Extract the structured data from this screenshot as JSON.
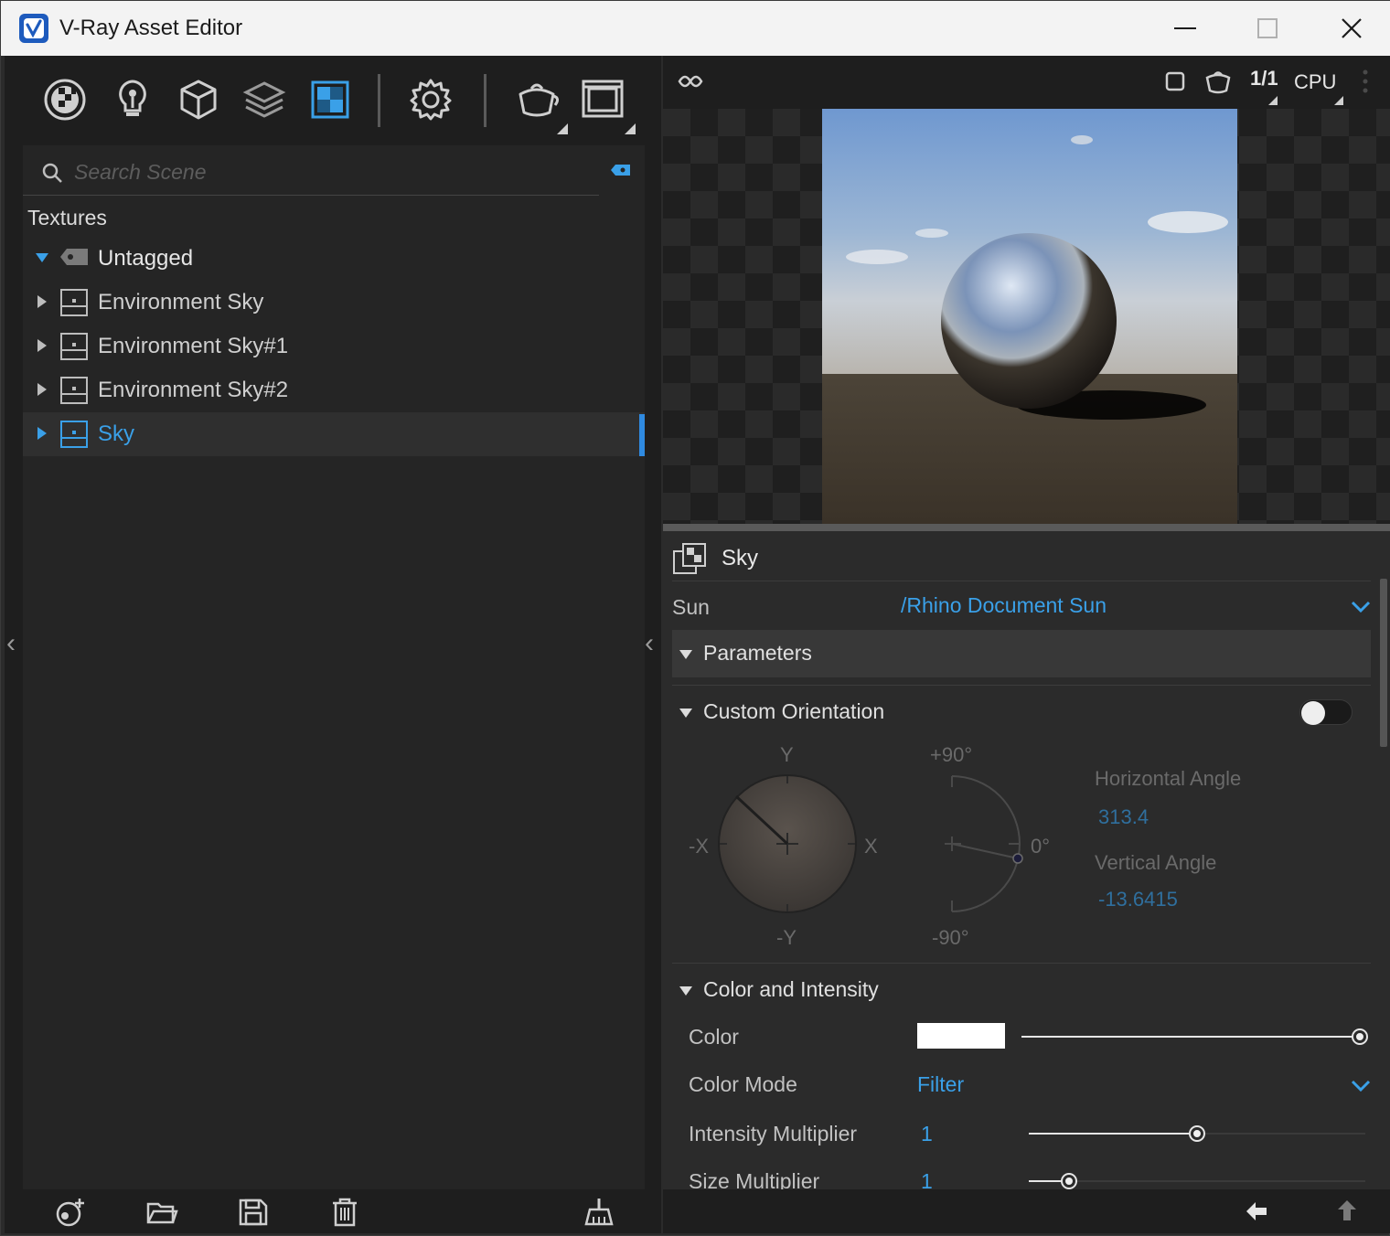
{
  "window": {
    "title": "V-Ray Asset Editor",
    "accent_color": "#3aa0e8"
  },
  "toolbar": {
    "icons": [
      "materials-icon",
      "lights-icon",
      "geometry-icon",
      "render-elements-icon",
      "textures-icon",
      "settings-icon",
      "render-icon",
      "frame-buffer-icon"
    ],
    "active": "textures-icon"
  },
  "search": {
    "placeholder": "Search Scene"
  },
  "tree": {
    "section": "Textures",
    "group": "Untagged",
    "items": [
      {
        "label": "Environment Sky"
      },
      {
        "label": "Environment Sky#1"
      },
      {
        "label": "Environment Sky#2"
      },
      {
        "label": "Sky",
        "selected": true
      }
    ]
  },
  "preview": {
    "ratio_label": "1/1",
    "engine": "CPU"
  },
  "properties": {
    "title": "Sky",
    "sun_label": "Sun",
    "sun_value": "/Rhino Document Sun",
    "parameters_label": "Parameters",
    "custom_orientation_label": "Custom Orientation",
    "custom_orientation_enabled": false,
    "orientation": {
      "y_pos": "Y",
      "y_neg": "-Y",
      "x_pos": "X",
      "x_neg": "-X",
      "plus90": "+90°",
      "zero": "0°",
      "minus90": "-90°",
      "horizontal_label": "Horizontal Angle",
      "horizontal_value": "313.4",
      "vertical_label": "Vertical Angle",
      "vertical_value": "-13.6415"
    },
    "color_intensity_label": "Color and Intensity",
    "color_label": "Color",
    "color_value": "#ffffff",
    "color_slider": 1.0,
    "color_mode_label": "Color Mode",
    "color_mode_value": "Filter",
    "intensity_label": "Intensity Multiplier",
    "intensity_value": "1",
    "intensity_slider": 0.5,
    "size_label": "Size Multiplier",
    "size_value": "1",
    "size_slider": 0.12
  }
}
